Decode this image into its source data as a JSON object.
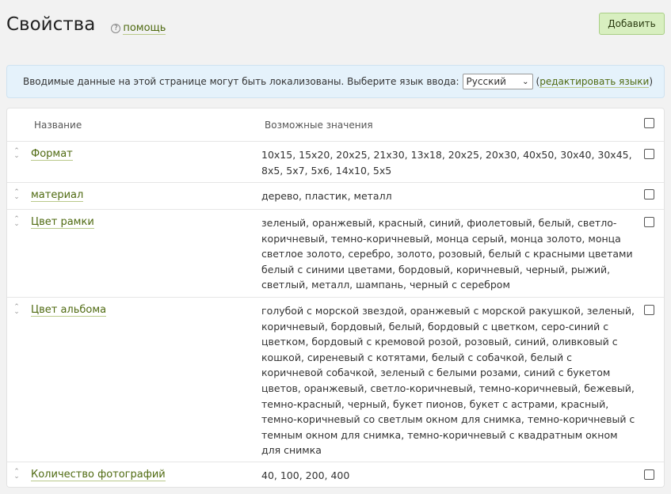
{
  "header": {
    "title": "Свойства",
    "help_label": "помощь"
  },
  "add_button": "Добавить",
  "locale": {
    "text": "Вводимые данные на этой странице могут быть локализованы. Выберите язык ввода:",
    "selected_language": "Русский",
    "edit_link": "редактировать языки"
  },
  "table": {
    "col_name": "Название",
    "col_values": "Возможные значения",
    "rows": [
      {
        "name": "Формат",
        "values": "10x15, 15x20, 20x25, 21x30, 13x18, 20x25, 20x30, 40x50, 30x40, 30x45, 8x5, 5x7, 5x6, 14x10, 5x5"
      },
      {
        "name": "материал",
        "values": "дерево, пластик, металл"
      },
      {
        "name": "Цвет рамки",
        "values": "зеленый, оранжевый, красный, синий, фиолетовый, белый, светло-коричневый, темно-коричневый, монца серый, монца золото, монца светлое золото, серебро, золото, розовый, белый с красными цветами белый с синими цветами, бордовый, коричневый, черный, рыжий, светлый, металл, шампань, черный с серебром"
      },
      {
        "name": "Цвет альбома",
        "values": "голубой с морской звездой, оранжевый с морской ракушкой, зеленый, коричневый, бордовый, белый, бордовый с цветком, серо-синий с цветком, бордовый с кремовой розой, розовый, синий, оливковый с кошкой, сиреневый с котятами, белый с собачкой, белый с коричневой собачкой, зеленый с белыми розами, синий с букетом цветов, оранжевый, светло-коричневый, темно-коричневый, бежевый, темно-красный, черный, букет пионов, букет с астрами, красный, темно-коричневый со светлым окном для снимка, темно-коричневый с темным окном для снимка, темно-коричневый с квадратным окном для снимка"
      },
      {
        "name": "Количество фотографий",
        "values": "40, 100, 200, 400"
      }
    ]
  }
}
